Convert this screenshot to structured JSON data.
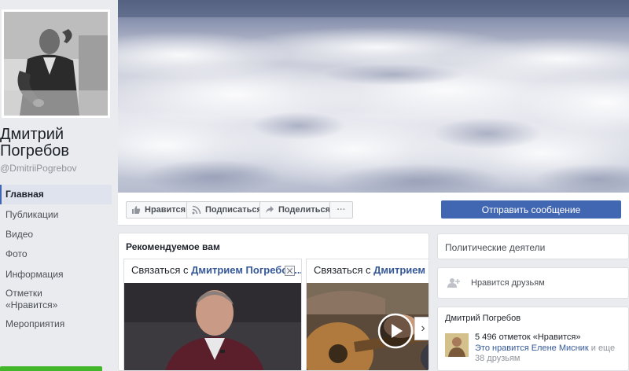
{
  "profile": {
    "name": "Дмитрий Погребов",
    "handle": "@DmitriiPogrebov"
  },
  "nav": {
    "items": [
      {
        "label": "Главная",
        "active": true
      },
      {
        "label": "Публикации"
      },
      {
        "label": "Видео"
      },
      {
        "label": "Фото"
      },
      {
        "label": "Информация"
      },
      {
        "label": "Отметки «Нравится»"
      },
      {
        "label": "Мероприятия"
      }
    ]
  },
  "actions": {
    "like": "Нравится",
    "follow": "Подписаться",
    "share": "Поделиться",
    "more": "···",
    "send_message": "Отправить сообщение"
  },
  "recommended": {
    "title": "Рекомендуемое вам",
    "cards": [
      {
        "prefix": "Связаться с ",
        "name": "Дмитрием Погребов..."
      },
      {
        "prefix": "Связаться с ",
        "name": "Дмитрием Погребов..."
      }
    ],
    "next": "›"
  },
  "sidebar": {
    "category": "Политические деятели",
    "friends_like": "Нравится друзьям",
    "page": {
      "title": "Дмитрий Погребов",
      "likes": "5 496 отметок «Нравится»",
      "friend_name": "Это нравится Елене Мисник",
      "friend_rest": " и еще 38 друзьям"
    }
  },
  "colors": {
    "brand": "#4267b2",
    "link": "#365899",
    "background": "#e9ebee",
    "green": "#42b72a"
  },
  "icons": [
    "thumbs-up-icon",
    "rss-icon",
    "share-arrow-icon",
    "more-dots-icon",
    "close-icon",
    "play-icon",
    "add-friend-icon",
    "chevron-right-icon"
  ]
}
